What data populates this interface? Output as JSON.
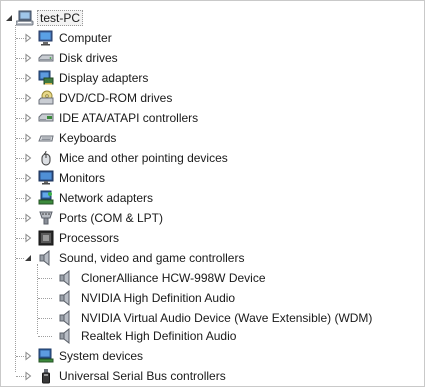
{
  "tree": {
    "root": {
      "label": "test-PC",
      "expanded": true,
      "icon": "computer-icon"
    },
    "categories": [
      {
        "label": "Computer",
        "icon": "computer-icon",
        "expanded": false
      },
      {
        "label": "Disk drives",
        "icon": "disk-drive-icon",
        "expanded": false
      },
      {
        "label": "Display adapters",
        "icon": "display-adapter-icon",
        "expanded": false
      },
      {
        "label": "DVD/CD-ROM drives",
        "icon": "dvd-drive-icon",
        "expanded": false
      },
      {
        "label": "IDE ATA/ATAPI controllers",
        "icon": "ide-controller-icon",
        "expanded": false
      },
      {
        "label": "Keyboards",
        "icon": "keyboard-icon",
        "expanded": false
      },
      {
        "label": "Mice and other pointing devices",
        "icon": "mouse-icon",
        "expanded": false
      },
      {
        "label": "Monitors",
        "icon": "monitor-icon",
        "expanded": false
      },
      {
        "label": "Network adapters",
        "icon": "network-adapter-icon",
        "expanded": false
      },
      {
        "label": "Ports (COM & LPT)",
        "icon": "port-icon",
        "expanded": false
      },
      {
        "label": "Processors",
        "icon": "processor-icon",
        "expanded": false
      },
      {
        "label": "Sound, video and game controllers",
        "icon": "speaker-icon",
        "expanded": true,
        "children": [
          {
            "label": "ClonerAlliance HCW-998W Device",
            "icon": "speaker-icon"
          },
          {
            "label": "NVIDIA High Definition Audio",
            "icon": "speaker-icon"
          },
          {
            "label": "NVIDIA Virtual Audio Device (Wave Extensible) (WDM)",
            "icon": "speaker-icon"
          },
          {
            "label": "Realtek High Definition Audio",
            "icon": "speaker-icon"
          }
        ]
      },
      {
        "label": "System devices",
        "icon": "system-device-icon",
        "expanded": false
      },
      {
        "label": "Universal Serial Bus controllers",
        "icon": "usb-icon",
        "expanded": false
      }
    ]
  },
  "colors": {
    "selection_bg": "#f3f3f3",
    "tree_line": "#a0a0a0",
    "text": "#1a1a1a"
  }
}
